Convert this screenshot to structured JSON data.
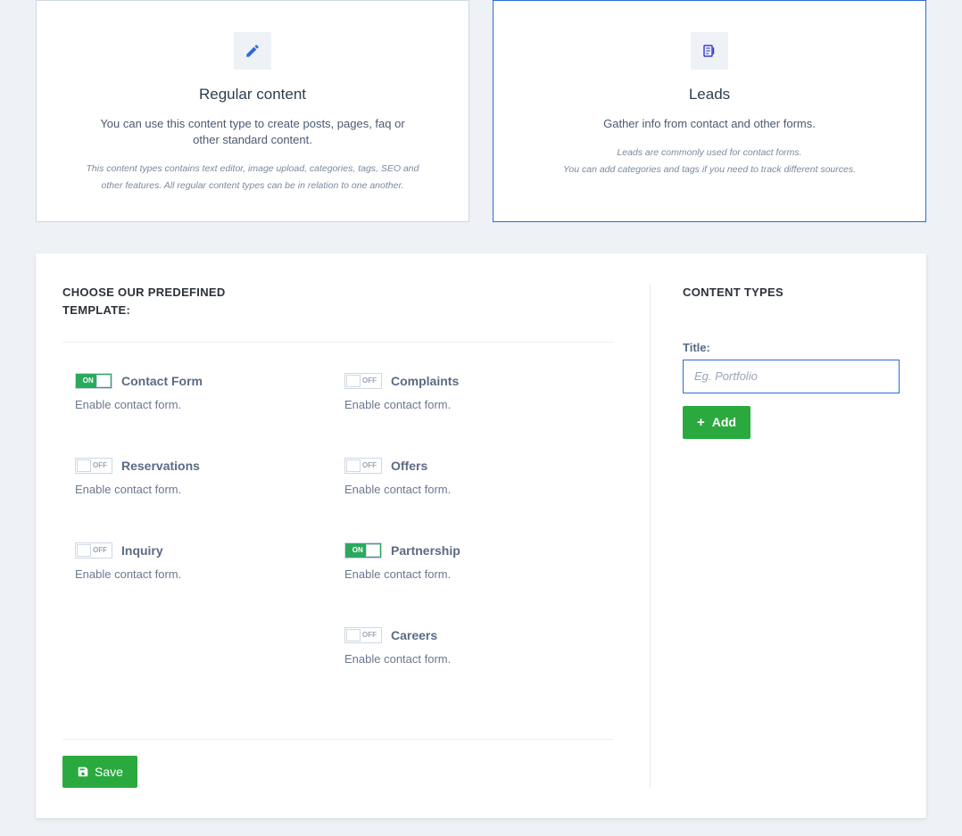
{
  "cards": {
    "regular": {
      "title": "Regular content",
      "sub": "You can use this content type to create posts, pages, faq or other standard content.",
      "note": "This content types contains text editor, image upload, categories, tags, SEO and other features. All regular content types can be in relation to one another.",
      "selected": false
    },
    "leads": {
      "title": "Leads",
      "sub": "Gather info from contact and other forms.",
      "note": "Leads are commonly used for contact forms.\nYou can add categories and tags if you need to track different sources.",
      "selected": true
    }
  },
  "templates": {
    "heading": "CHOOSE OUR PREDEFINED TEMPLATE:",
    "on_label": "ON",
    "off_label": "OFF",
    "items": [
      {
        "title": "Contact Form",
        "desc": "Enable contact form.",
        "on": true
      },
      {
        "title": "Complaints",
        "desc": "Enable contact form.",
        "on": false
      },
      {
        "title": "Reservations",
        "desc": "Enable contact form.",
        "on": false
      },
      {
        "title": "Offers",
        "desc": "Enable contact form.",
        "on": false
      },
      {
        "title": "Inquiry",
        "desc": "Enable contact form.",
        "on": false
      },
      {
        "title": "Partnership",
        "desc": "Enable contact form.",
        "on": true
      },
      {
        "title": "",
        "desc": "",
        "on": null
      },
      {
        "title": "Careers",
        "desc": "Enable contact form.",
        "on": false
      }
    ],
    "save_label": "Save"
  },
  "sidebar": {
    "heading": "CONTENT TYPES",
    "title_label": "Title:",
    "title_placeholder": "Eg. Portfolio",
    "title_value": "",
    "add_label": "Add"
  }
}
